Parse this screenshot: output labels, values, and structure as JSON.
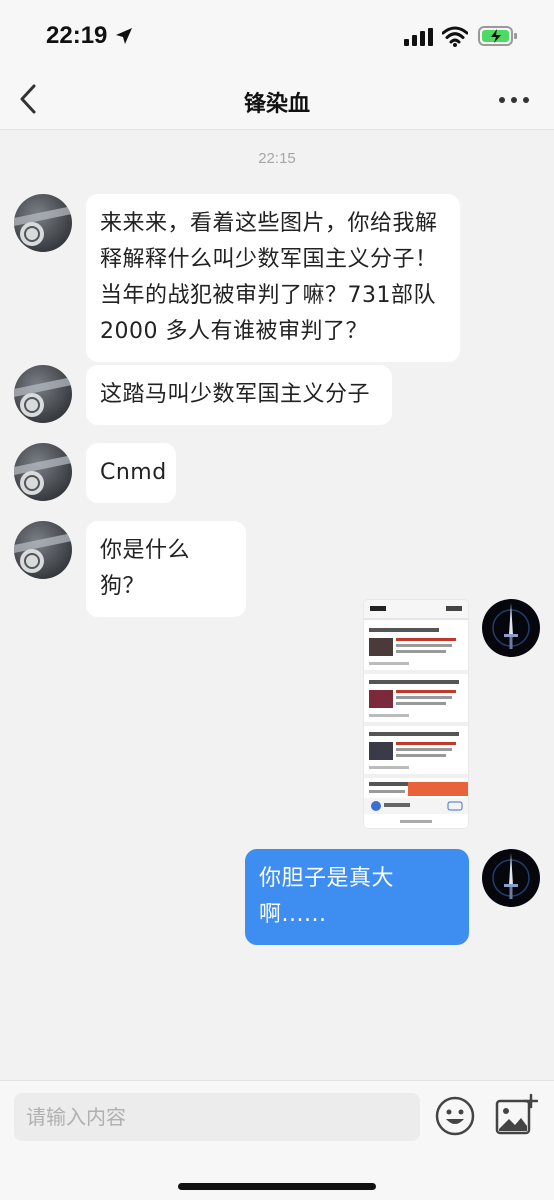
{
  "status_bar": {
    "time": "22:19"
  },
  "nav": {
    "title": "锋染血"
  },
  "chat": {
    "timestamp": "22:15",
    "messages": [
      {
        "side": "left",
        "text": "来来来，看着这些图片，你给我解\n释解释什么叫少数军国主义分子！\n当年的战犯被审判了嘛？731部队\n2000 多人有谁被审判了？"
      },
      {
        "side": "left",
        "text": "这踏马叫少数军国主义分子"
      },
      {
        "side": "left",
        "text": "Cnmd"
      },
      {
        "side": "left",
        "text": "你是什么狗？"
      },
      {
        "side": "right",
        "type": "image",
        "content": "screenshot-thumbnail"
      },
      {
        "side": "right",
        "text": "你胆子是真大啊......"
      }
    ]
  },
  "input": {
    "placeholder": "请输入内容"
  },
  "icons": {
    "back": "chevron-left-icon",
    "more": "more-dots-icon",
    "emoji": "emoji-icon",
    "image": "image-add-icon"
  },
  "colors": {
    "accent": "#3d8ef0",
    "background": "#f2f2f2",
    "bubble_left": "#ffffff",
    "battery": "#4cd964"
  }
}
